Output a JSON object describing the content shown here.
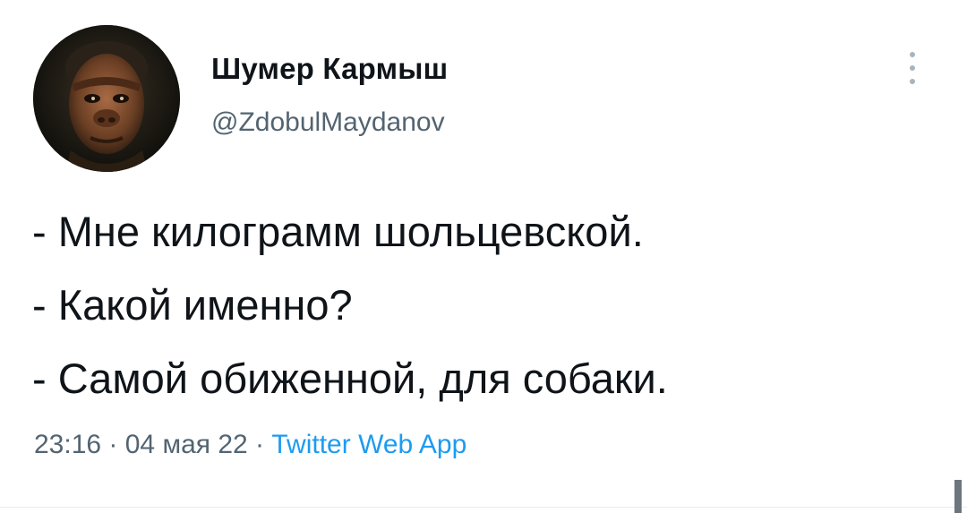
{
  "author": {
    "display_name": "Шумер Кармыш",
    "handle": "@ZdobulMaydanov",
    "avatar_icon": "hominid-portrait-avatar"
  },
  "menu": {
    "icon": "more-vertical-icon"
  },
  "tweet": {
    "lines": [
      "- Мне килограмм шольцевской.",
      "- Какой именно?",
      "- Самой обиженной, для собаки."
    ]
  },
  "meta": {
    "time": "23:16",
    "separator1": " · ",
    "date": "04 мая 22",
    "separator2": " · ",
    "source": "Twitter Web App"
  },
  "colors": {
    "text": "#0f1419",
    "secondary": "#536471",
    "link": "#1d9bf0"
  }
}
